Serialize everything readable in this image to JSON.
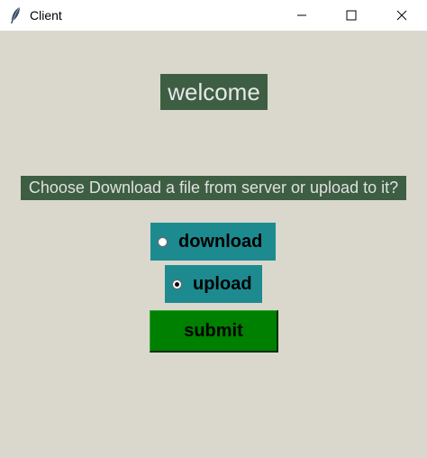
{
  "window": {
    "title": "Client",
    "icon": "feather-icon",
    "controls": [
      "minimize-icon",
      "maximize-icon",
      "close-icon"
    ]
  },
  "main": {
    "welcome_label": "welcome",
    "prompt_label": "Choose Download a file from server or upload to it?",
    "options": [
      {
        "label": "download",
        "selected": false
      },
      {
        "label": "upload",
        "selected": true
      }
    ],
    "submit_label": "submit"
  },
  "colors": {
    "background": "#dad8cd",
    "label_bg": "#3d5e42",
    "radio_bg": "#1d8a90",
    "submit_bg": "#008000"
  }
}
